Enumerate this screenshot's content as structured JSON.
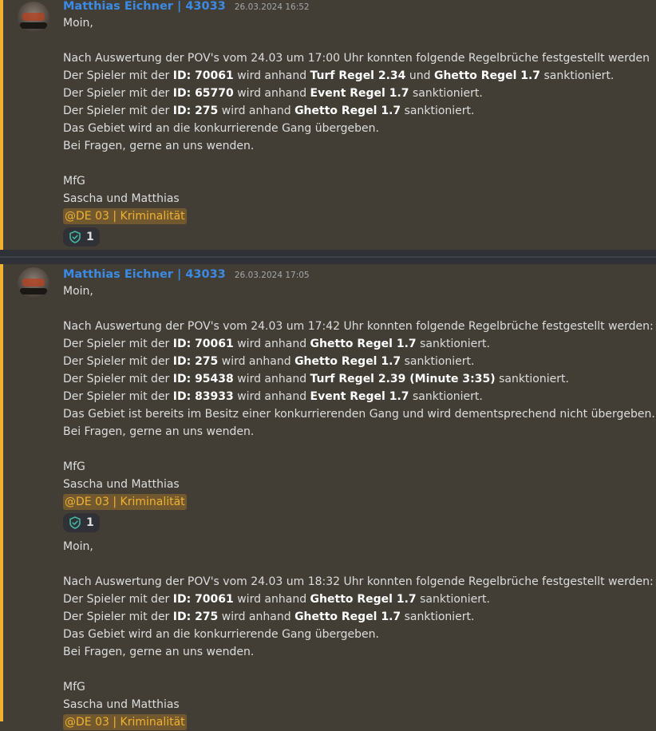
{
  "messages": [
    {
      "author": "Matthias Eichner | 43033",
      "timestamp": "26.03.2024 16:52",
      "lines": [
        [
          {
            "t": "Moin,"
          }
        ],
        [],
        [
          {
            "t": "Nach Auswertung der POV's vom 24.03 um 17:00 Uhr konnten folgende Regelbrüche festgestellt werden"
          }
        ],
        [
          {
            "t": "Der Spieler mit der "
          },
          {
            "t": "ID: 70061",
            "b": true
          },
          {
            "t": " wird anhand "
          },
          {
            "t": "Turf Regel 2.34",
            "b": true
          },
          {
            "t": " und "
          },
          {
            "t": "Ghetto Regel 1.7",
            "b": true
          },
          {
            "t": " sanktioniert."
          }
        ],
        [
          {
            "t": "Der Spieler mit der "
          },
          {
            "t": "ID: 65770",
            "b": true
          },
          {
            "t": " wird anhand "
          },
          {
            "t": "Event Regel 1.7",
            "b": true
          },
          {
            "t": " sanktioniert."
          }
        ],
        [
          {
            "t": "Der Spieler mit der "
          },
          {
            "t": "ID: 275",
            "b": true
          },
          {
            "t": " wird anhand "
          },
          {
            "t": "Ghetto Regel 1.7",
            "b": true
          },
          {
            "t": " sanktioniert."
          }
        ],
        [
          {
            "t": "Das Gebiet wird an die konkurrierende Gang übergeben."
          }
        ],
        [
          {
            "t": "Bei Fragen, gerne an uns wenden."
          }
        ],
        [],
        [
          {
            "t": "MfG"
          }
        ],
        [
          {
            "t": "Sascha und Matthias"
          }
        ]
      ],
      "mention": "@DE 03 | Kriminalität",
      "reaction": {
        "icon": "shield-check-icon",
        "count": "1"
      }
    },
    {
      "author": "Matthias Eichner | 43033",
      "timestamp": "26.03.2024 17:05",
      "lines": [
        [
          {
            "t": "Moin,"
          }
        ],
        [],
        [
          {
            "t": "Nach Auswertung der POV's vom 24.03 um 17:42 Uhr konnten folgende Regelbrüche festgestellt werden:"
          }
        ],
        [
          {
            "t": "Der Spieler mit der "
          },
          {
            "t": "ID: 70061",
            "b": true
          },
          {
            "t": " wird anhand "
          },
          {
            "t": "Ghetto Regel 1.7",
            "b": true
          },
          {
            "t": " sanktioniert."
          }
        ],
        [
          {
            "t": "Der Spieler mit der "
          },
          {
            "t": "ID: 275",
            "b": true
          },
          {
            "t": " wird anhand "
          },
          {
            "t": "Ghetto Regel 1.7",
            "b": true
          },
          {
            "t": " sanktioniert."
          }
        ],
        [
          {
            "t": "Der Spieler mit der "
          },
          {
            "t": "ID: 95438",
            "b": true
          },
          {
            "t": " wird anhand "
          },
          {
            "t": "Turf Regel 2.39 (Minute 3:35)",
            "b": true
          },
          {
            "t": " sanktioniert."
          }
        ],
        [
          {
            "t": "Der Spieler mit der "
          },
          {
            "t": "ID: 83933",
            "b": true
          },
          {
            "t": " wird anhand "
          },
          {
            "t": "Event Regel 1.7",
            "b": true
          },
          {
            "t": " sanktioniert."
          }
        ],
        [
          {
            "t": "Das Gebiet ist bereits im Besitz einer konkurrierenden Gang und wird dementsprechend nicht übergeben."
          }
        ],
        [
          {
            "t": "Bei Fragen, gerne an uns wenden."
          }
        ],
        [],
        [
          {
            "t": "MfG"
          }
        ],
        [
          {
            "t": "Sascha und Matthias"
          }
        ]
      ],
      "mention": "@DE 03 | Kriminalität",
      "reaction": {
        "icon": "shield-check-icon",
        "count": "1"
      }
    },
    {
      "lines": [
        [
          {
            "t": "Moin,"
          }
        ],
        [],
        [
          {
            "t": "Nach Auswertung der POV's vom 24.03 um 18:32 Uhr konnten folgende Regelbrüche festgestellt werden:"
          }
        ],
        [
          {
            "t": "Der Spieler mit der "
          },
          {
            "t": "ID: 70061",
            "b": true
          },
          {
            "t": " wird anhand "
          },
          {
            "t": "Ghetto Regel 1.7",
            "b": true
          },
          {
            "t": " sanktioniert."
          }
        ],
        [
          {
            "t": "Der Spieler mit der "
          },
          {
            "t": "ID: 275",
            "b": true
          },
          {
            "t": " wird anhand "
          },
          {
            "t": "Ghetto Regel 1.7",
            "b": true
          },
          {
            "t": " sanktioniert."
          }
        ],
        [
          {
            "t": "Das Gebiet wird an die konkurrierende Gang übergeben."
          }
        ],
        [
          {
            "t": "Bei Fragen, gerne an uns wenden."
          }
        ],
        [],
        [
          {
            "t": "MfG"
          }
        ],
        [
          {
            "t": "Sascha und Matthias"
          }
        ]
      ],
      "mention": "@DE 03 | Kriminalität"
    }
  ],
  "colors": {
    "background": "#433e35",
    "highlight_bar": "#f0b232",
    "author": "#3b8ae6",
    "mention_text": "#f0b232",
    "reaction_icon": "#43b5a0"
  }
}
